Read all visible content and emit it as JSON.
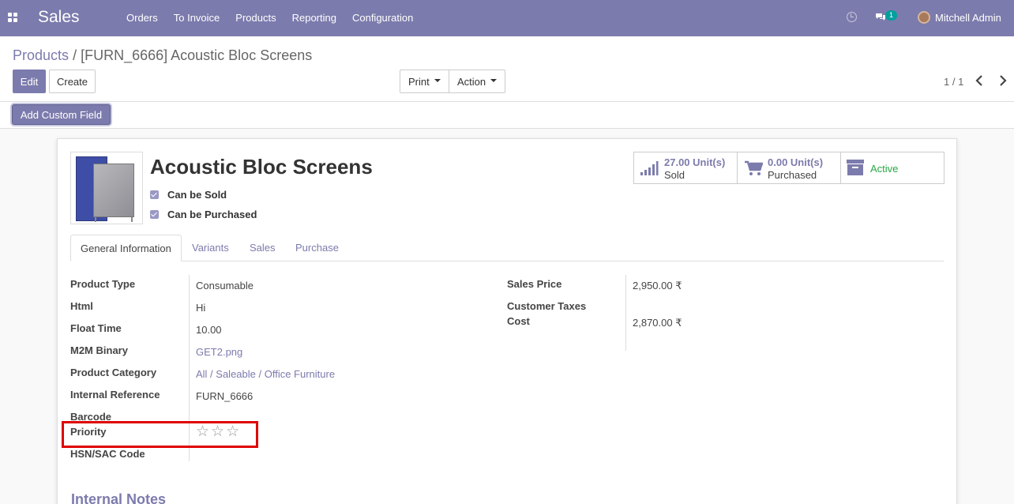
{
  "navbar": {
    "brand": "Sales",
    "menu": [
      "Orders",
      "To Invoice",
      "Products",
      "Reporting",
      "Configuration"
    ],
    "chat_count": "1",
    "user_name": "Mitchell Admin"
  },
  "breadcrumb": {
    "parent": "Products",
    "separator": "/",
    "current": "[FURN_6666] Acoustic Bloc Screens"
  },
  "toolbar": {
    "edit": "Edit",
    "create": "Create",
    "print": "Print",
    "action": "Action",
    "pager": "1 / 1"
  },
  "custom_field_button": "Add Custom Field",
  "product": {
    "title": "Acoustic Bloc Screens",
    "can_be_sold": "Can be Sold",
    "can_be_purchased": "Can be Purchased"
  },
  "smart_buttons": {
    "sold_value": "27.00 Unit(s)",
    "sold_label": "Sold",
    "purchased_value": "0.00 Unit(s)",
    "purchased_label": "Purchased",
    "active_label": "Active"
  },
  "tabs": [
    "General Information",
    "Variants",
    "Sales",
    "Purchase"
  ],
  "left_fields": {
    "product_type": {
      "label": "Product Type",
      "value": "Consumable"
    },
    "html": {
      "label": "Html",
      "value": "Hi"
    },
    "float_time": {
      "label": "Float Time",
      "value": "10.00"
    },
    "m2m_binary": {
      "label": "M2M Binary",
      "value": "GET2.png"
    },
    "product_category": {
      "label": "Product Category",
      "value": "All / Saleable / Office Furniture"
    },
    "internal_reference": {
      "label": "Internal Reference",
      "value": "FURN_6666"
    },
    "barcode": {
      "label": "Barcode",
      "value": ""
    },
    "priority": {
      "label": "Priority",
      "stars_total": 3,
      "stars_filled": 0
    },
    "hsn_sac_code": {
      "label": "HSN/SAC Code",
      "value": ""
    }
  },
  "right_fields": {
    "sales_price": {
      "label": "Sales Price",
      "value": "2,950.00 ₹"
    },
    "customer_taxes": {
      "label": "Customer Taxes",
      "value": ""
    },
    "cost": {
      "label": "Cost",
      "value": "2,870.00 ₹"
    }
  },
  "internal_notes_title": "Internal Notes",
  "colors": {
    "brand": "#7c7bad",
    "highlight": "#e00000",
    "active": "#28a745",
    "badge": "#00a09d"
  }
}
